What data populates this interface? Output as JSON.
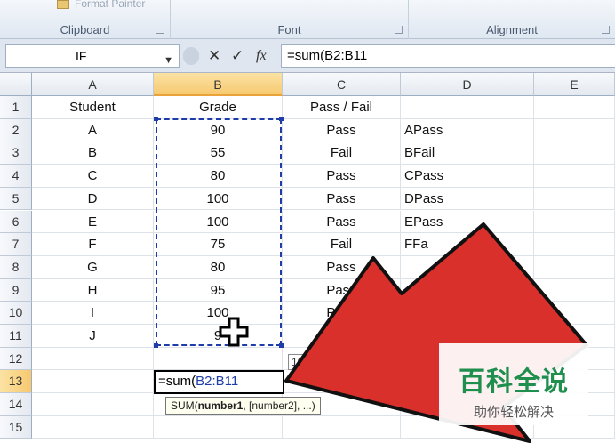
{
  "ribbon": {
    "groups": [
      {
        "label": "Clipboard"
      },
      {
        "label": "Font"
      },
      {
        "label": "Alignment"
      }
    ],
    "format_painter_label": "Format Painter"
  },
  "formula_bar": {
    "name_box": "IF",
    "cancel_glyph": "✕",
    "enter_glyph": "✓",
    "fx_glyph": "fx",
    "formula": "=sum(B2:B11"
  },
  "columns": [
    "A",
    "B",
    "C",
    "D",
    "E"
  ],
  "active_column": "B",
  "rows": [
    "1",
    "2",
    "3",
    "4",
    "5",
    "6",
    "7",
    "8",
    "9",
    "10",
    "11",
    "12",
    "13",
    "14",
    "15"
  ],
  "active_row": "13",
  "headers": {
    "student": "Student",
    "grade": "Grade",
    "pass_fail": "Pass / Fail"
  },
  "data": [
    {
      "student": "A",
      "grade": "90",
      "pass": "Pass",
      "d": "APass"
    },
    {
      "student": "B",
      "grade": "55",
      "pass": "Fail",
      "d": "BFail"
    },
    {
      "student": "C",
      "grade": "80",
      "pass": "Pass",
      "d": "CPass"
    },
    {
      "student": "D",
      "grade": "100",
      "pass": "Pass",
      "d": "DPass"
    },
    {
      "student": "E",
      "grade": "100",
      "pass": "Pass",
      "d": "EPass"
    },
    {
      "student": "F",
      "grade": "75",
      "pass": "Fail",
      "d": "FFa"
    },
    {
      "student": "G",
      "grade": "80",
      "pass": "Pass",
      "d": ""
    },
    {
      "student": "H",
      "grade": "95",
      "pass": "Pass",
      "d": ""
    },
    {
      "student": "I",
      "grade": "100",
      "pass": "Pass",
      "d": ""
    },
    {
      "student": "J",
      "grade": "9",
      "pass": "P",
      "d": ""
    }
  ],
  "edit_cell": {
    "prefix": "=sum(",
    "ref": "B2:B11"
  },
  "tooltip": {
    "fn": "SUM(",
    "arg1": "number1",
    "rest": ", [number2], ...)"
  },
  "autocomplete_value": "10",
  "watermark": {
    "title": "百科全说",
    "subtitle": "助你轻松解决"
  },
  "colors": {
    "arrow": "#d9302c",
    "selection": "#1e3da8",
    "header_active": "#f7c970",
    "watermark_green": "#1f8f4e"
  }
}
